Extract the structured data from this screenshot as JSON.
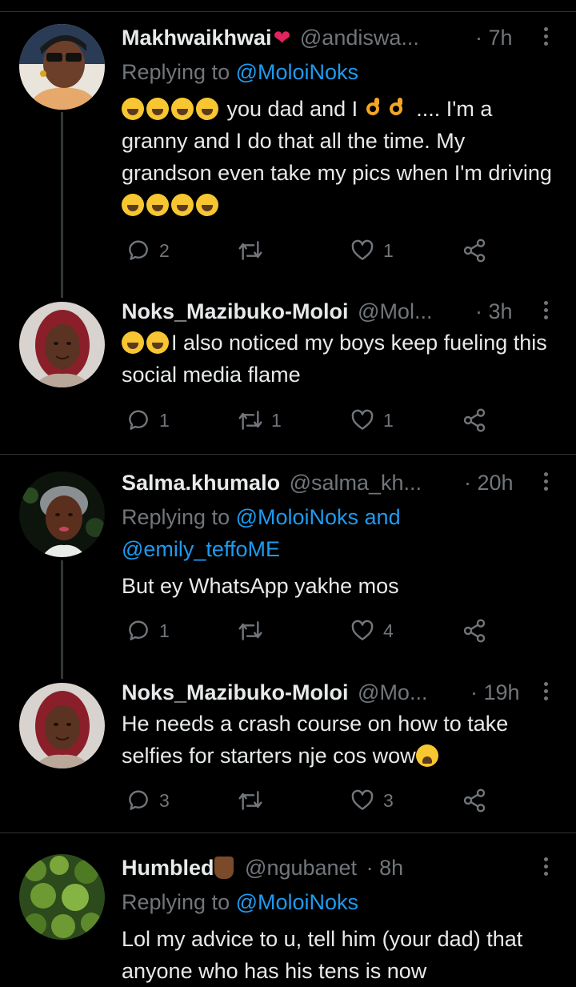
{
  "tweets": [
    {
      "name": "Makhwaikhwai",
      "handle": "@andiswa...",
      "time": "· 7h",
      "reply_prefix": "Replying to ",
      "reply_to": "@MoloiNoks",
      "reply_to_line2": "",
      "text_parts": [
        "you dad and I",
        ".... I'm a granny and I do that all the time.  My grandson even take my pics when I'm driving"
      ],
      "counts": {
        "reply": "2",
        "retweet": "",
        "like": "1"
      }
    },
    {
      "name": "Noks_Mazibuko-Moloi",
      "handle": "@Mol...",
      "time": "· 3h",
      "text_parts": [
        "I also noticed my boys keep fueling this social media flame"
      ],
      "counts": {
        "reply": "1",
        "retweet": "1",
        "like": "1"
      }
    },
    {
      "name": "Salma.khumalo",
      "handle": "@salma_kh...",
      "time": "· 20h",
      "reply_prefix": "Replying to ",
      "reply_to": "@MoloiNoks and",
      "reply_to_line2": "@emily_teffoME",
      "text_parts": [
        "But ey WhatsApp yakhe mos"
      ],
      "counts": {
        "reply": "1",
        "retweet": "",
        "like": "4"
      }
    },
    {
      "name": "Noks_Mazibuko-Moloi",
      "handle": "@Mo...",
      "time": "· 19h",
      "text_parts": [
        "He needs a crash course on how to take selfies for starters nje cos wow"
      ],
      "counts": {
        "reply": "3",
        "retweet": "",
        "like": "3"
      }
    },
    {
      "name": "Humbled",
      "handle": "@ngubanet",
      "time": "· 8h",
      "reply_prefix": "Replying to ",
      "reply_to": "@MoloiNoks",
      "text_parts": [
        "Lol my advice to u, tell him (your dad) that anyone who has his tens is now"
      ]
    }
  ],
  "icons": {
    "reply": "speech-bubble-icon",
    "retweet": "retweet-icon",
    "like": "heart-icon",
    "share": "share-icon",
    "more": "more-vertical-icon"
  },
  "colors": {
    "background": "#000000",
    "text": "#e7e9ea",
    "muted": "#71767b",
    "accent": "#1d9bf0",
    "divider": "#2f3336"
  }
}
